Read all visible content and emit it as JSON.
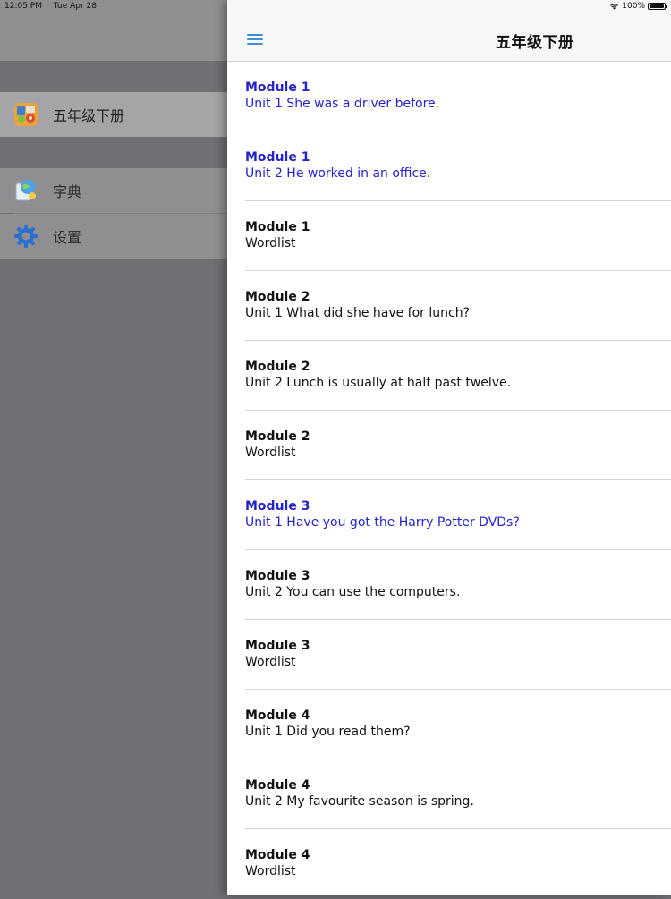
{
  "status_bar": {
    "time": "12:05 PM",
    "date": "Tue Apr 28",
    "battery": "100%",
    "battery_level": 1.0
  },
  "sidebar": {
    "items": [
      {
        "label": "五年级下册",
        "icon": "book-app-icon",
        "selected": true
      },
      {
        "label": "字典",
        "icon": "dictionary-icon",
        "selected": false
      },
      {
        "label": "设置",
        "icon": "gear-icon",
        "selected": false
      }
    ]
  },
  "navbar": {
    "title": "五年级下册",
    "menu_icon": "hamburger-menu-icon"
  },
  "lessons": [
    {
      "module": "Module 1",
      "unit": "Unit 1 She was a driver before.",
      "highlighted": true
    },
    {
      "module": "Module 1",
      "unit": "Unit 2 He worked in an office.",
      "highlighted": true
    },
    {
      "module": "Module 1",
      "unit": "Wordlist",
      "highlighted": false
    },
    {
      "module": "Module 2",
      "unit": "Unit 1 What did she have for lunch?",
      "highlighted": false
    },
    {
      "module": "Module 2",
      "unit": "Unit 2 Lunch is usually at half past twelve.",
      "highlighted": false
    },
    {
      "module": "Module 2",
      "unit": "Wordlist",
      "highlighted": false
    },
    {
      "module": "Module 3",
      "unit": "Unit 1 Have you got the Harry Potter DVDs?",
      "highlighted": true
    },
    {
      "module": "Module 3",
      "unit": "Unit 2 You can use the computers.",
      "highlighted": false
    },
    {
      "module": "Module 3",
      "unit": "Wordlist",
      "highlighted": false
    },
    {
      "module": "Module 4",
      "unit": "Unit 1 Did you read them?",
      "highlighted": false
    },
    {
      "module": "Module 4",
      "unit": "Unit 2 My favourite season is spring.",
      "highlighted": false
    },
    {
      "module": "Module 4",
      "unit": "Wordlist",
      "highlighted": false
    }
  ],
  "colors": {
    "link_blue": "#2323c8",
    "accent": "#3b8fe0"
  }
}
